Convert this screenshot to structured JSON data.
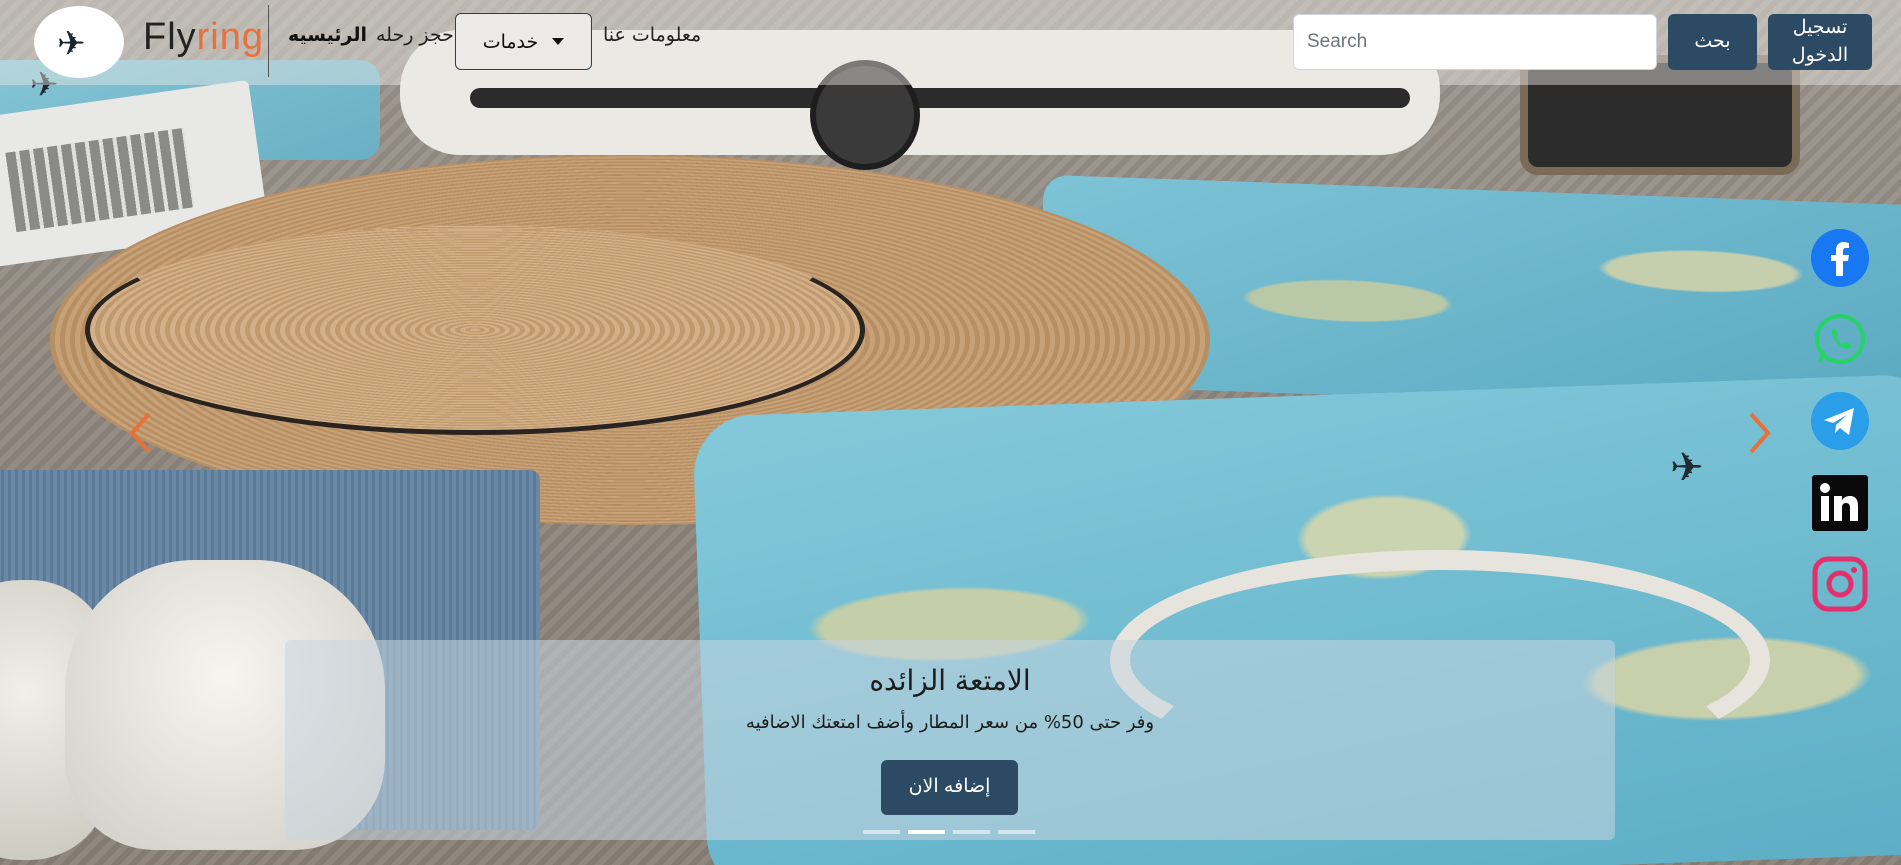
{
  "navbar": {
    "brand": {
      "part1": "Fly",
      "part2": "ring",
      "logo_icon": "airplane-icon"
    },
    "links": {
      "home": "الرئيسيه",
      "book_trip": "حجز رحله",
      "services": "خدمات",
      "about": "معلومات عنا"
    },
    "search": {
      "placeholder": "Search",
      "value": ""
    },
    "search_button": "بحث",
    "login_button": "تسجيل الدخول"
  },
  "social": [
    {
      "name": "facebook",
      "icon": "facebook-icon",
      "color": "#1877f2"
    },
    {
      "name": "whatsapp",
      "icon": "whatsapp-icon",
      "color": "#25d366"
    },
    {
      "name": "telegram",
      "icon": "telegram-icon",
      "color": "#2a9ee8"
    },
    {
      "name": "linkedin",
      "icon": "linkedin-icon",
      "color": "#0a0a0a"
    },
    {
      "name": "instagram",
      "icon": "instagram-icon",
      "color": "#e1306c"
    }
  ],
  "carousel": {
    "caption_title": "الامتعة الزائده",
    "caption_text": "وفر حتى 50% من سعر المطار وأضف امتعتك الاضافيه",
    "caption_button": "إضافه الان",
    "slide_count": 4,
    "active_slide": 2
  },
  "colors": {
    "accent": "#2c4a63",
    "brand_orange": "#e8703a",
    "arrow": "#e8703a"
  }
}
